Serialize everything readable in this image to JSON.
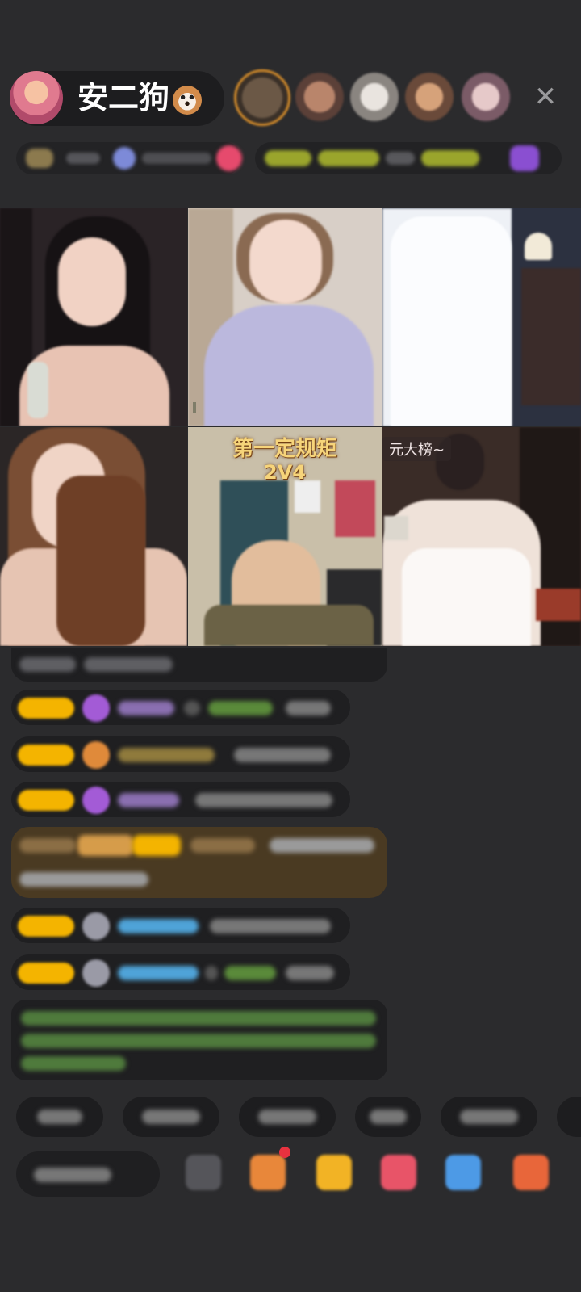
{
  "host": {
    "name": "安二狗",
    "emoji_icon": "dog-face-icon"
  },
  "header": {
    "close_icon": "close-icon"
  },
  "video_grid": {
    "tile_5_overlay": {
      "title": "第一定规矩",
      "score": "2V4"
    },
    "tile_6_overlay": {
      "label": "元大榜~"
    }
  },
  "colors": {
    "page_bg": "#2b2b2d",
    "badge_gold": "#f4b400",
    "chat_accent_purple": "#a35bd6",
    "chat_accent_blue": "#4fa3d8",
    "chat_accent_green": "#79c14e",
    "notification_red": "#e8323f"
  }
}
